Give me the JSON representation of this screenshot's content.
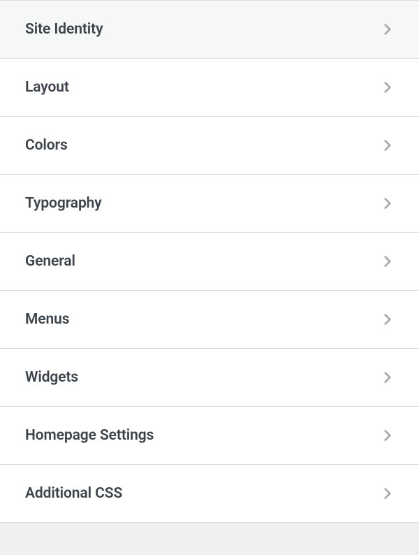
{
  "customizer": {
    "sections": [
      {
        "id": "site-identity",
        "label": "Site Identity"
      },
      {
        "id": "layout",
        "label": "Layout"
      },
      {
        "id": "colors",
        "label": "Colors"
      },
      {
        "id": "typography",
        "label": "Typography"
      },
      {
        "id": "general",
        "label": "General"
      },
      {
        "id": "menus",
        "label": "Menus"
      },
      {
        "id": "widgets",
        "label": "Widgets"
      },
      {
        "id": "homepage-settings",
        "label": "Homepage Settings"
      },
      {
        "id": "additional-css",
        "label": "Additional CSS"
      }
    ]
  }
}
